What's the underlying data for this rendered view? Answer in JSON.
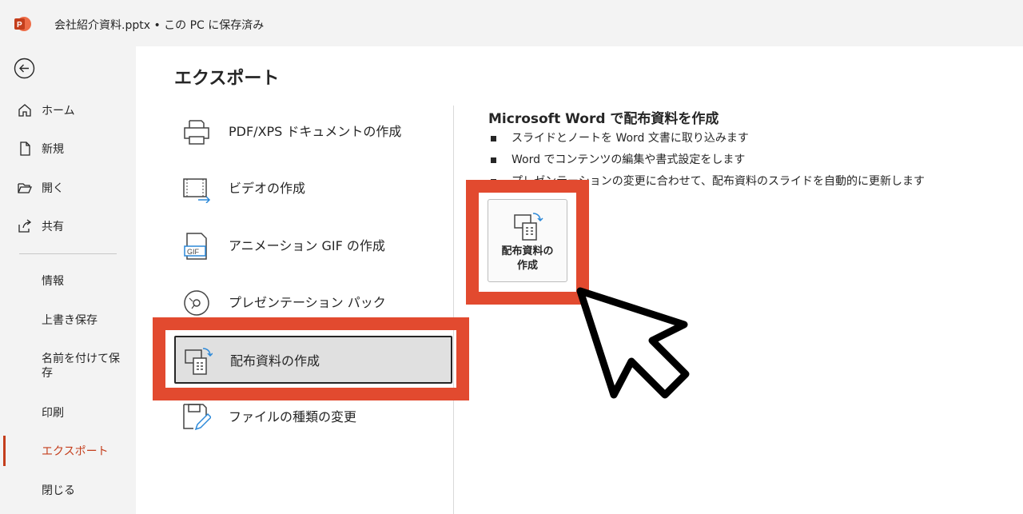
{
  "titlebar": {
    "title": "会社紹介資料.pptx • この PC に保存済み",
    "app_icon": "powerpoint-icon",
    "accent_color": "#c43e1c"
  },
  "nav": {
    "back_icon": "back-arrow-icon",
    "items": [
      {
        "label": "ホーム",
        "icon": "home-icon"
      },
      {
        "label": "新規",
        "icon": "new-file-icon"
      },
      {
        "label": "開く",
        "icon": "folder-open-icon"
      },
      {
        "label": "共有",
        "icon": "share-icon"
      },
      {
        "label": "情報"
      },
      {
        "label": "上書き保存"
      },
      {
        "label": "名前を付けて保存"
      },
      {
        "label": "印刷"
      },
      {
        "label": "エクスポート",
        "active": true
      },
      {
        "label": "閉じる"
      }
    ]
  },
  "main": {
    "title": "エクスポート",
    "options": [
      {
        "label": "PDF/XPS ドキュメントの作成",
        "icon": "pdf-xps-icon"
      },
      {
        "label": "ビデオの作成",
        "icon": "video-icon"
      },
      {
        "label": "アニメーション GIF の作成",
        "icon": "gif-icon"
      },
      {
        "label": "プレゼンテーション パック",
        "icon": "cd-icon"
      },
      {
        "label": "配布資料の作成",
        "icon": "handout-icon",
        "selected": true
      },
      {
        "label": "ファイルの種類の変更",
        "icon": "change-file-type-icon"
      }
    ]
  },
  "detail": {
    "title": "Microsoft Word で配布資料を作成",
    "bullets": [
      "スライドとノートを Word 文書に取り込みます",
      "Word でコンテンツの編集や書式設定をします",
      "プレゼンテーションの変更に合わせて、配布資料のスライドを自動的に更新します"
    ],
    "button_label_line1": "配布資料の",
    "button_label_line2": "作成",
    "button_icon": "handout-icon"
  },
  "annotation": {
    "highlight_color": "#e24a2f",
    "pointer": "mouse-pointer-icon"
  }
}
